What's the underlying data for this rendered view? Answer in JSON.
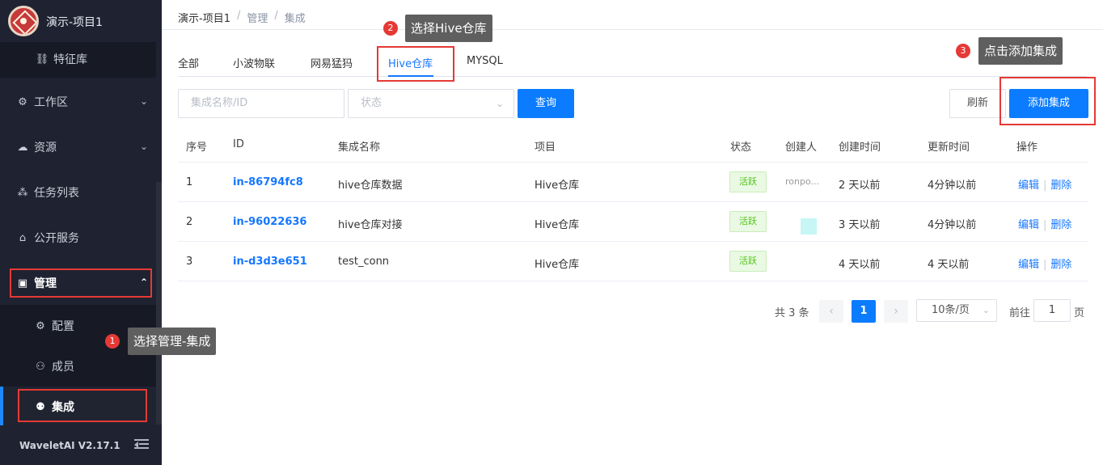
{
  "sidebar": {
    "brand_title": "演示-项目1",
    "items": [
      {
        "label": "特征库",
        "icon": "feature-store-icon"
      },
      {
        "label": "工作区",
        "icon": "gear-icon"
      },
      {
        "label": "资源",
        "icon": "cloud-icon"
      },
      {
        "label": "任务列表",
        "icon": "task-list-icon"
      },
      {
        "label": "公开服务",
        "icon": "public-service-icon"
      },
      {
        "label": "管理",
        "icon": "management-icon"
      }
    ],
    "sub_items": [
      {
        "label": "配置",
        "icon": "gear-icon"
      },
      {
        "label": "成员",
        "icon": "users-icon"
      },
      {
        "label": "集成",
        "icon": "integration-icon"
      }
    ],
    "version": "WaveletAI V2.17.1"
  },
  "breadcrumb": {
    "items": [
      "演示-项目1",
      "管理",
      "集成"
    ],
    "separator": "/"
  },
  "tabs": [
    "全部",
    "小波物联",
    "网易猛犸",
    "Hive仓库",
    "MYSQL"
  ],
  "active_tab": "Hive仓库",
  "filters": {
    "name_placeholder": "集成名称/ID",
    "status_placeholder": "状态",
    "query_label": "查询",
    "refresh_label": "刷新",
    "add_label": "添加集成"
  },
  "table": {
    "headers": [
      "序号",
      "ID",
      "集成名称",
      "项目",
      "状态",
      "创建人",
      "创建时间",
      "更新时间",
      "操作"
    ],
    "rows": [
      {
        "index": "1",
        "id": "in-86794fc8",
        "name": "hive仓库数据",
        "project": "Hive仓库",
        "status": "活跃",
        "creator": "ronpo...",
        "created": "2 天以前",
        "updated": "4分钟以前",
        "edit": "编辑",
        "delete": "删除"
      },
      {
        "index": "2",
        "id": "in-96022636",
        "name": "hive仓库对接",
        "project": "Hive仓库",
        "status": "活跃",
        "creator": "",
        "created": "3 天以前",
        "updated": "4分钟以前",
        "edit": "编辑",
        "delete": "删除"
      },
      {
        "index": "3",
        "id": "in-d3d3e651",
        "name": "test_conn",
        "project": "Hive仓库",
        "status": "活跃",
        "creator": "",
        "created": "4 天以前",
        "updated": "4 天以前",
        "edit": "编辑",
        "delete": "删除"
      }
    ]
  },
  "pagination": {
    "total": "共 3 条",
    "current_page": "1",
    "page_size": "10条/页",
    "goto_label": "前往",
    "goto_value": "1",
    "goto_suffix": "页",
    "prev_symbol": "‹",
    "next_symbol": "›"
  },
  "callouts": [
    {
      "number": "1",
      "text": "选择管理-集成"
    },
    {
      "number": "2",
      "text": "选择Hive仓库"
    },
    {
      "number": "3",
      "text": "点击添加集成"
    }
  ],
  "colors": {
    "sidebar_bg": "#1f2230",
    "primary": "#0b7cff",
    "highlight_red": "#e53935",
    "badge_green": "#52c41a"
  }
}
